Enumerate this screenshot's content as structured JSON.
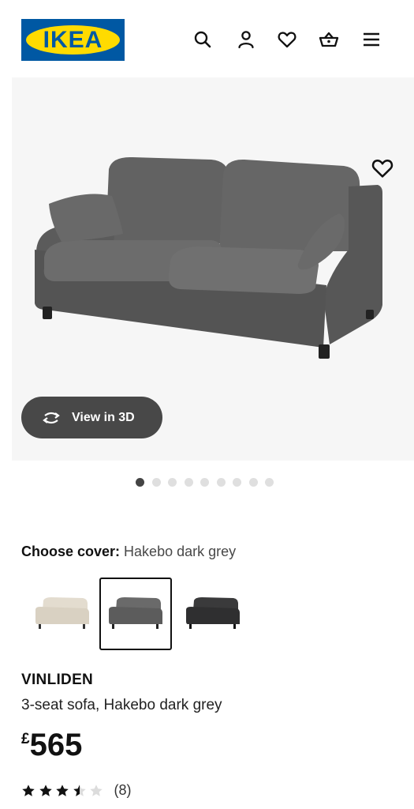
{
  "header": {
    "logo_text": "IKEA",
    "icons": [
      "search-icon",
      "account-icon",
      "heart-icon",
      "basket-icon",
      "menu-icon"
    ]
  },
  "gallery": {
    "favourite_icon": "heart-icon",
    "view_3d_label": "View in 3D",
    "view_3d_icon": "rotate-icon",
    "image_count": 9,
    "active_image": 1
  },
  "cover": {
    "label": "Choose cover:",
    "selected_value": "Hakebo dark grey",
    "options": [
      {
        "color": "#e3dccf",
        "selected": false
      },
      {
        "color": "#5c5c5c",
        "selected": true
      },
      {
        "color": "#2f2f30",
        "selected": false
      }
    ]
  },
  "product": {
    "name": "VINLIDEN",
    "description": "3-seat sofa, Hakebo dark grey",
    "currency": "£",
    "price": "565",
    "rating": 3.5,
    "rating_max": 5,
    "review_count": "(8)"
  },
  "colors": {
    "ikea_blue": "#0058a3",
    "ikea_yellow": "#ffdb00",
    "button_dark": "#484848",
    "text": "#111111"
  }
}
